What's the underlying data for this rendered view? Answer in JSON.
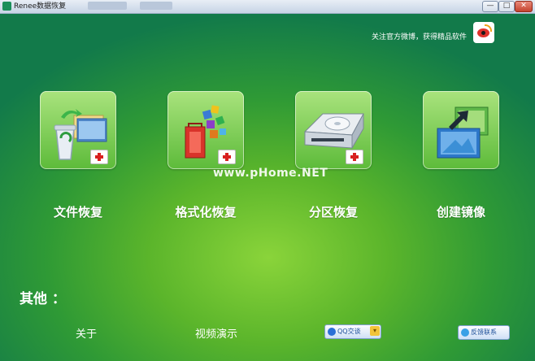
{
  "window": {
    "title": "Renee数据恢复",
    "min_glyph": "—",
    "max_glyph": "□",
    "close_glyph": "✕"
  },
  "topbar": {
    "follow_text": "关注官方微博，获得精品软件",
    "weibo_icon": "weibo-icon"
  },
  "tiles": [
    {
      "label": "文件恢复",
      "icon": "recycle-bin-files-icon"
    },
    {
      "label": "格式化恢复",
      "icon": "cleanup-blocks-icon"
    },
    {
      "label": "分区恢复",
      "icon": "hard-drive-icon"
    },
    {
      "label": "创建镜像",
      "icon": "disk-image-icon"
    }
  ],
  "watermark": "www.pHome.NET",
  "other": {
    "heading": "其他 ：",
    "about": "关于",
    "video": "视频演示",
    "qq_badge": "QQ交谈",
    "feedback_badge": "反馈联系"
  },
  "colors": {
    "accent_dark": "#127a4a",
    "accent_light": "#8ad43a",
    "tile": "#7ccf55",
    "plus_red": "#d82020"
  }
}
